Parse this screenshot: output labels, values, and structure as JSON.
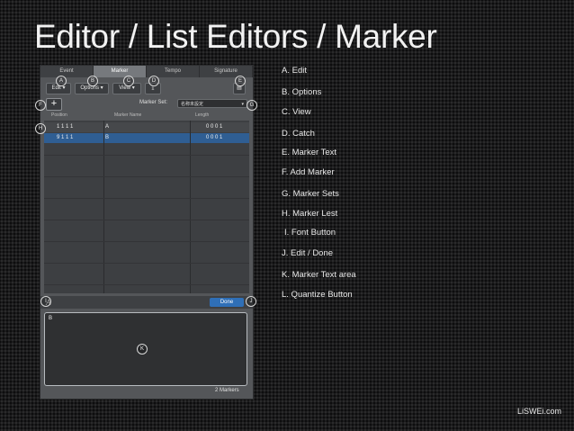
{
  "title": "Editor / List Editors / Marker",
  "panel": {
    "tabs": [
      {
        "label": "Event",
        "active": false
      },
      {
        "label": "Marker",
        "active": true
      },
      {
        "label": "Tempo",
        "active": false
      },
      {
        "label": "Signature",
        "active": false
      }
    ],
    "toolbar": {
      "edit_label": "Edit",
      "options_label": "Options",
      "view_label": "View"
    },
    "marker_set_label": "Marker Set:",
    "marker_set_value": "名称未設定",
    "columns": [
      "Position",
      "Marker Name",
      "Length"
    ],
    "rows": [
      {
        "position": "1  1  1    1",
        "name": "A",
        "length": "0  0  0    1",
        "selected": false
      },
      {
        "position": "9  1  1    1",
        "name": "B",
        "length": "0  0  0    1",
        "selected": true
      }
    ],
    "font_button": "A",
    "done_label": "Done",
    "marker_text": "B",
    "marker_count": "2 Markers"
  },
  "callouts": [
    "A",
    "B",
    "C",
    "D",
    "E",
    "F",
    "G",
    "H",
    "I",
    "J",
    "K",
    "L"
  ],
  "legend": [
    "A. Edit",
    "B. Options",
    "C. View",
    "D. Catch",
    "E. Marker Text",
    "F. Add Marker",
    "G. Marker Sets",
    "H. Marker Lest",
    "I. Font Button",
    "J. Edit / Done",
    "K. Marker Text area",
    "L. Quantize Button"
  ],
  "credit": "LiSWEi.com"
}
